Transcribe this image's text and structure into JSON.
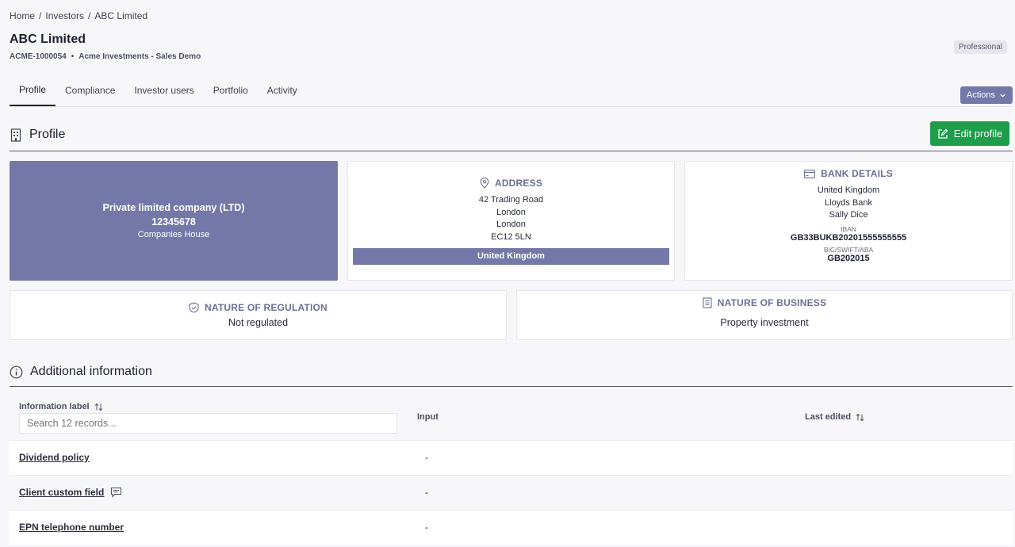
{
  "breadcrumb": {
    "home": "Home",
    "investors": "Investors",
    "current": "ABC Limited",
    "separator": "/"
  },
  "header": {
    "title": "ABC Limited",
    "id": "ACME-1000054",
    "bullet": "•",
    "org": "Acme Investments - Sales Demo",
    "badge": "Professional"
  },
  "tabs": [
    {
      "label": "Profile"
    },
    {
      "label": "Compliance"
    },
    {
      "label": "Investor users"
    },
    {
      "label": "Portfolio"
    },
    {
      "label": "Activity"
    }
  ],
  "actions": {
    "label": "Actions"
  },
  "profile": {
    "heading": "Profile",
    "edit_label": "Edit profile"
  },
  "company": {
    "type": "Private limited company (LTD)",
    "number": "12345678",
    "registry": "Companies House"
  },
  "address": {
    "title": "ADDRESS",
    "line1": "42 Trading Road",
    "line2": "London",
    "line3": "London",
    "postcode": "EC12 5LN",
    "country": "United Kingdom"
  },
  "bank": {
    "title": "BANK DETAILS",
    "country": "United Kingdom",
    "bank": "Lloyds Bank",
    "holder": "Sally Dice",
    "iban_label": "IBAN",
    "iban": "GB33BUKB20201555555555",
    "bic_label": "BIC/SWIFT/ABA",
    "bic": "GB202015"
  },
  "regulation": {
    "title": "NATURE OF REGULATION",
    "value": "Not regulated"
  },
  "business": {
    "title": "NATURE OF BUSINESS",
    "value": "Property investment"
  },
  "additional": {
    "heading": "Additional information",
    "columns": {
      "label": "Information label",
      "input": "Input",
      "edited": "Last edited"
    },
    "search_placeholder": "Search 12 records...",
    "rows": [
      {
        "label": "Dividend policy",
        "value": "-"
      },
      {
        "label": "Client custom field",
        "value": "-"
      },
      {
        "label": "EPN telephone number",
        "value": "-"
      }
    ]
  },
  "colors": {
    "accent": "#7478a8",
    "success": "#1e9d4a"
  }
}
